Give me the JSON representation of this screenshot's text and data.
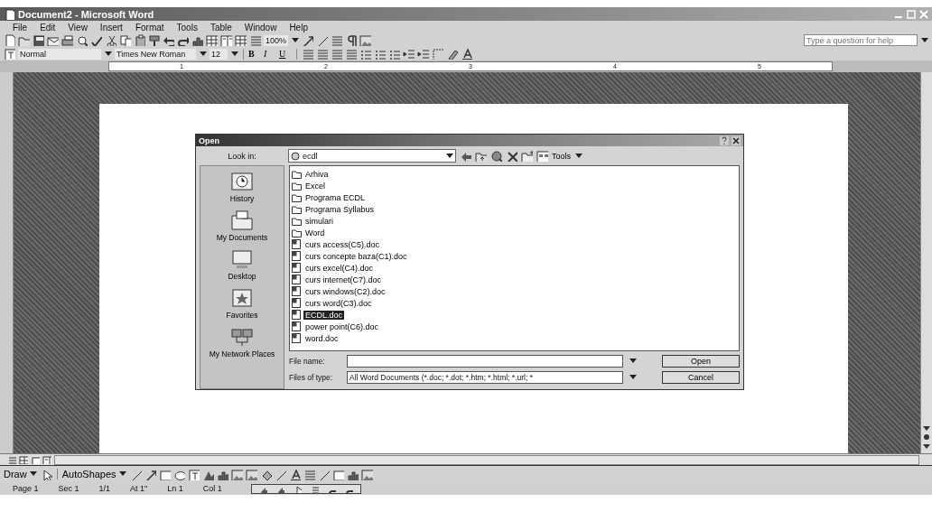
{
  "window": {
    "title": "Document2 - Microsoft Word"
  },
  "menu": [
    "File",
    "Edit",
    "View",
    "Insert",
    "Format",
    "Tools",
    "Table",
    "Window",
    "Help"
  ],
  "help_box": {
    "placeholder": "Type a question for help"
  },
  "standard_toolbar": {
    "zoom": "100%"
  },
  "formatting_toolbar": {
    "style": "Normal",
    "font": "Times New Roman",
    "size": "12",
    "format_buttons": [
      "B",
      "I",
      "U"
    ]
  },
  "ruler": {
    "marks": [
      "1",
      "2",
      "3",
      "4",
      "5"
    ]
  },
  "dialog": {
    "title": "Open",
    "look_in_label": "Look in:",
    "look_in": "ecdl",
    "tools": "Tools",
    "places": [
      "History",
      "My Documents",
      "Desktop",
      "Favorites",
      "My Network Places"
    ],
    "files": [
      {
        "name": "Arhiva",
        "kind": "folder",
        "selected": false
      },
      {
        "name": "Excel",
        "kind": "folder",
        "selected": false
      },
      {
        "name": "Programa ECDL",
        "kind": "folder",
        "selected": false
      },
      {
        "name": "Programa Syllabus",
        "kind": "folder",
        "selected": false
      },
      {
        "name": "simulari",
        "kind": "folder",
        "selected": false
      },
      {
        "name": "Word",
        "kind": "folder",
        "selected": false
      },
      {
        "name": "curs access(C5).doc",
        "kind": "doc",
        "selected": false
      },
      {
        "name": "curs concepte baza(C1).doc",
        "kind": "doc",
        "selected": false
      },
      {
        "name": "curs excel(C4).doc",
        "kind": "doc",
        "selected": false
      },
      {
        "name": "curs internet(C7).doc",
        "kind": "doc",
        "selected": false
      },
      {
        "name": "curs windows(C2).doc",
        "kind": "doc",
        "selected": false
      },
      {
        "name": "curs word(C3).doc",
        "kind": "doc",
        "selected": false
      },
      {
        "name": "ECDL.doc",
        "kind": "doc",
        "selected": true
      },
      {
        "name": "power point(C6).doc",
        "kind": "doc",
        "selected": false
      },
      {
        "name": "word.doc",
        "kind": "doc",
        "selected": false
      }
    ],
    "file_name_label": "File name:",
    "files_of_type_label": "Files of type:",
    "files_of_type": "All Word Documents (*.doc; *.dot; *.htm; *.html; *.url; *",
    "buttons": [
      "Open",
      "Cancel"
    ]
  },
  "drawing_toolbar": {
    "draw": "Draw",
    "autoshapes": "AutoShapes"
  },
  "status_bar": [
    "Page 1",
    "Sec 1",
    "1/1",
    "At 1\"",
    "Ln 1",
    "Col 1"
  ]
}
